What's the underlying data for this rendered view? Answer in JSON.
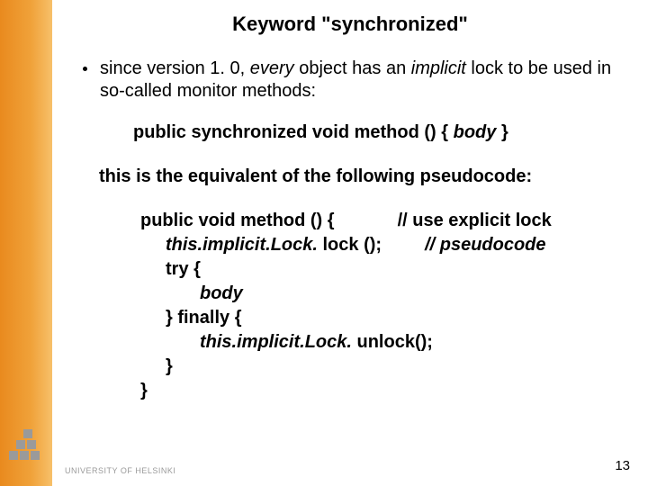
{
  "title": "Keyword \"synchronized\"",
  "bullet": {
    "pre": "since version 1. 0, ",
    "every": "every",
    "mid": " object has an ",
    "implicit": "implicit",
    "post": " lock to be used in so-called monitor methods:"
  },
  "code1": {
    "public": "public ",
    "sync": "synchronized",
    "void": " void ",
    "method": "method",
    "parens": " () { ",
    "body": "body",
    "close": " }"
  },
  "equiv": "this is the equivalent of the following pseudocode:",
  "code2": {
    "l1a": "public void ",
    "l1b": "method",
    "l1c": " () {",
    "l1comment": "// use explicit lock",
    "l2a": "this.",
    "l2b": "implicit.Lock.",
    "l2c": " lock ();",
    "l2comment": "// pseudocode",
    "l3": "try {",
    "l4": "body",
    "l5": "} finally {",
    "l6a": "this.",
    "l6b": "implicit.Lock.",
    "l6c": " unlock();",
    "l7": "}",
    "l8": "}"
  },
  "footer": {
    "pagenum": "13",
    "university": "UNIVERSITY OF HELSINKI"
  }
}
